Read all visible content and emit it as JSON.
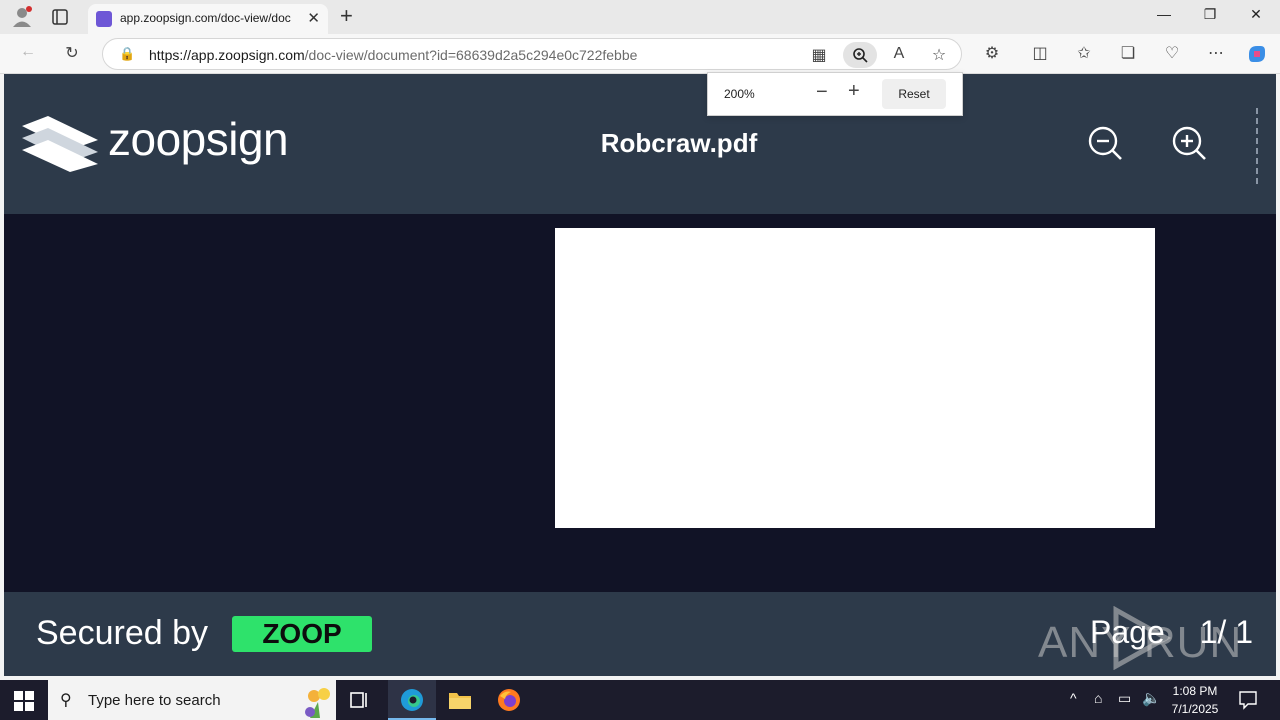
{
  "browser": {
    "tab_title": "app.zoopsign.com/doc-view/doc",
    "url_host": "https://app.zoopsign.com",
    "url_path": "/doc-view/document?id=68639d2a5c294e0c722febbe",
    "new_tab": "+",
    "close_tab": "✕"
  },
  "zoom_popup": {
    "percent": "200%",
    "reset_label": "Reset"
  },
  "app": {
    "brand": "zoopsign",
    "document_title": "Robcraw.pdf",
    "secured_label": "Secured by",
    "zoop_badge": "ZOOP",
    "page_label": "Page",
    "page_current": "1",
    "page_separator": "/",
    "page_total": "1",
    "watermark": "ANY RUN"
  },
  "taskbar": {
    "search_placeholder": "Type here to search",
    "time": "1:08 PM",
    "date": "7/1/2025"
  },
  "colors": {
    "header_bg": "#2d3a4a",
    "doc_area_bg": "#111326",
    "zoop_green": "#2ee26b",
    "taskbar_bg": "#1c1c2c"
  }
}
